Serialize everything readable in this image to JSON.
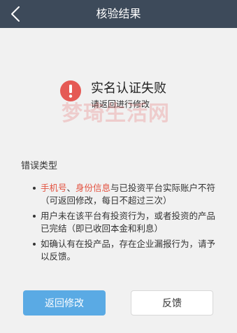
{
  "header": {
    "title": "核验结果"
  },
  "result": {
    "title": "实名认证失败",
    "subtitle": "请返回进行修改"
  },
  "watermark": "梦琦生活网",
  "errors": {
    "label": "错误类型",
    "items": [
      {
        "hl1": "手机号",
        "sep": "、",
        "hl2": "身份信息",
        "text": "与已投资平台实际账户不符（可返回修改，每日不超过三次）"
      },
      {
        "text": "用户未在该平台有投资行为，或者投资的产品已完结（即已收回本金和利息）"
      },
      {
        "text": "如确认有在投产品，存在企业漏报行为，请予以反馈。"
      }
    ]
  },
  "buttons": {
    "back_edit": "返回修改",
    "feedback": "反馈"
  },
  "colors": {
    "nav_bg": "#3d4a5a",
    "error": "#e55a55",
    "highlight": "#e3513f",
    "primary": "#5aaae4"
  }
}
